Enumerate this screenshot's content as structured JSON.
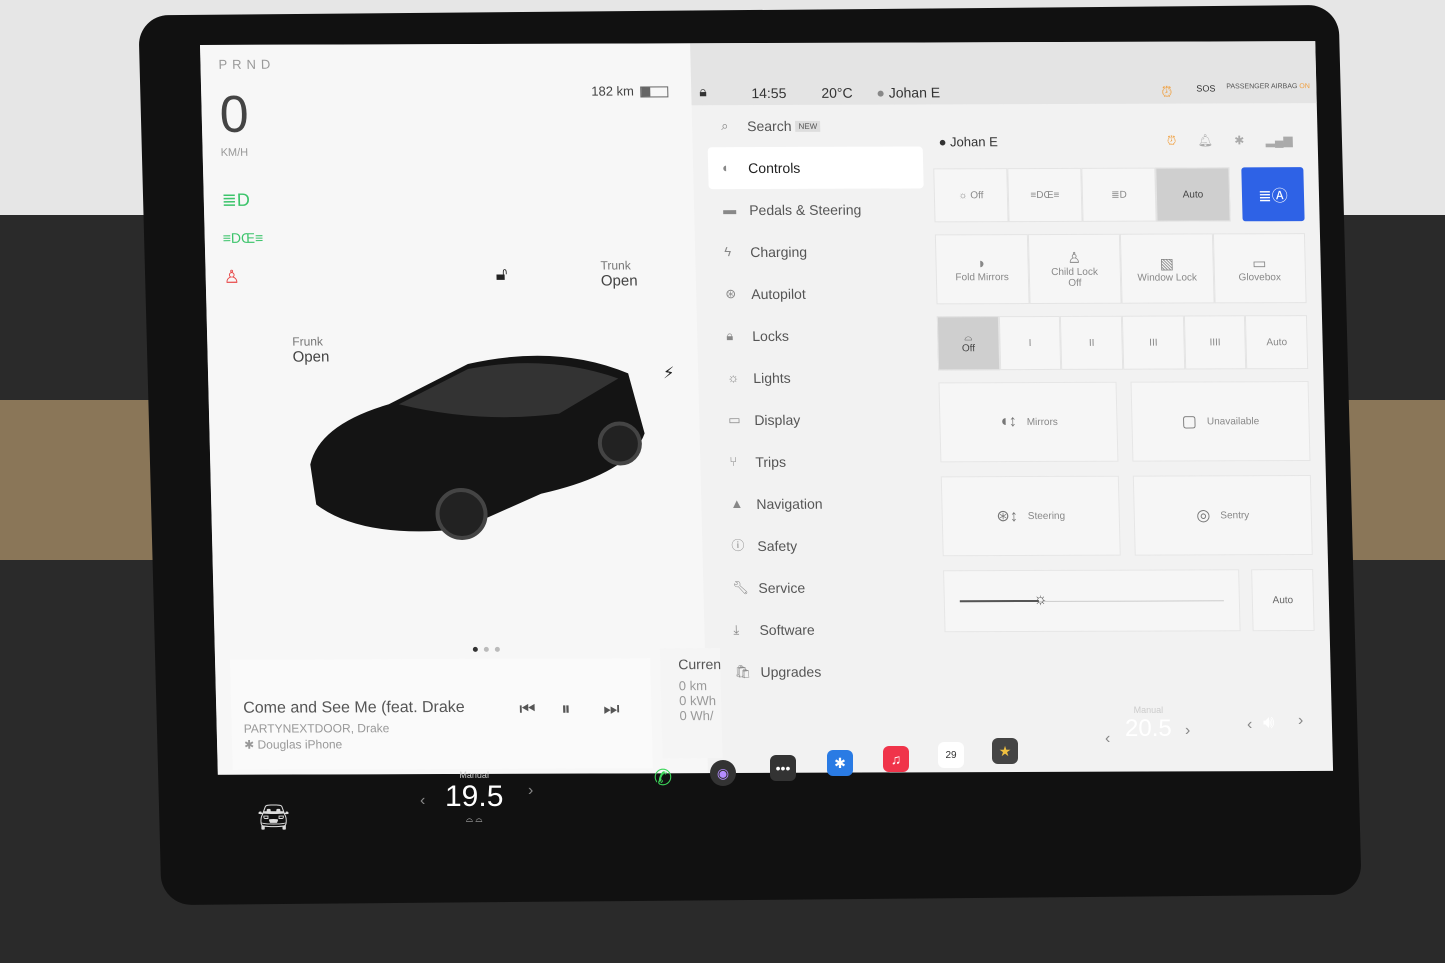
{
  "drive": {
    "gears": "PRND",
    "speed": "0",
    "speed_unit": "KM/H",
    "range": "182 km",
    "battery_level": 0.35
  },
  "indicators": [
    {
      "icon": "low-beam-icon",
      "color": "#3cc46b"
    },
    {
      "icon": "parking-lights-icon",
      "color": "#3cc46b"
    },
    {
      "icon": "seatbelt-warning-icon",
      "color": "#e84848"
    }
  ],
  "car": {
    "frunk_label": "Frunk",
    "frunk_state": "Open",
    "trunk_label": "Trunk",
    "trunk_state": "Open"
  },
  "media": {
    "title": "Come and See Me (feat. Drake",
    "artist": "PARTYNEXTDOOR, Drake",
    "source": "Douglas iPhone"
  },
  "trip": {
    "title": "Curren",
    "distance": "0 km",
    "energy": "0 kWh",
    "efficiency": "0 Wh/"
  },
  "status": {
    "time": "14:55",
    "temp": "20°C",
    "user": "Johan E",
    "sos": "SOS",
    "airbag_label": "PASSENGER AIRBAG",
    "airbag_state": "ON"
  },
  "menu": [
    {
      "label": "Search",
      "badge": "NEW",
      "icon": "search-icon"
    },
    {
      "label": "Controls",
      "icon": "toggle-icon",
      "selected": true
    },
    {
      "label": "Pedals & Steering",
      "icon": "car-icon"
    },
    {
      "label": "Charging",
      "icon": "bolt-icon"
    },
    {
      "label": "Autopilot",
      "icon": "steering-wheel-icon"
    },
    {
      "label": "Locks",
      "icon": "lock-icon"
    },
    {
      "label": "Lights",
      "icon": "sun-icon"
    },
    {
      "label": "Display",
      "icon": "display-icon"
    },
    {
      "label": "Trips",
      "icon": "trips-icon"
    },
    {
      "label": "Navigation",
      "icon": "navigation-icon"
    },
    {
      "label": "Safety",
      "icon": "safety-icon"
    },
    {
      "label": "Service",
      "icon": "wrench-icon"
    },
    {
      "label": "Software",
      "icon": "download-icon"
    },
    {
      "label": "Upgrades",
      "icon": "bag-icon"
    }
  ],
  "controls": {
    "user": "Johan E",
    "lights": [
      "Off",
      "",
      "",
      "Auto"
    ],
    "lights_selected": "Auto",
    "accent": "#2e62e6",
    "buttons": [
      {
        "label": "Fold Mirrors"
      },
      {
        "label": "Child Lock",
        "sub": "Off"
      },
      {
        "label": "Window Lock"
      },
      {
        "label": "Glovebox"
      }
    ],
    "wipers": [
      "Off",
      "I",
      "II",
      "III",
      "IIII",
      "Auto"
    ],
    "wipers_selected": "Off",
    "tiles": [
      "Mirrors",
      "Unavailable",
      "Steering",
      "Sentry"
    ],
    "brightness_percent": 30,
    "brightness_auto": "Auto"
  },
  "climate": {
    "driver_mode": "Manual",
    "driver_temp": "19.5",
    "passenger_mode": "Manual",
    "passenger_temp": "20.5",
    "calendar_day": "29"
  }
}
